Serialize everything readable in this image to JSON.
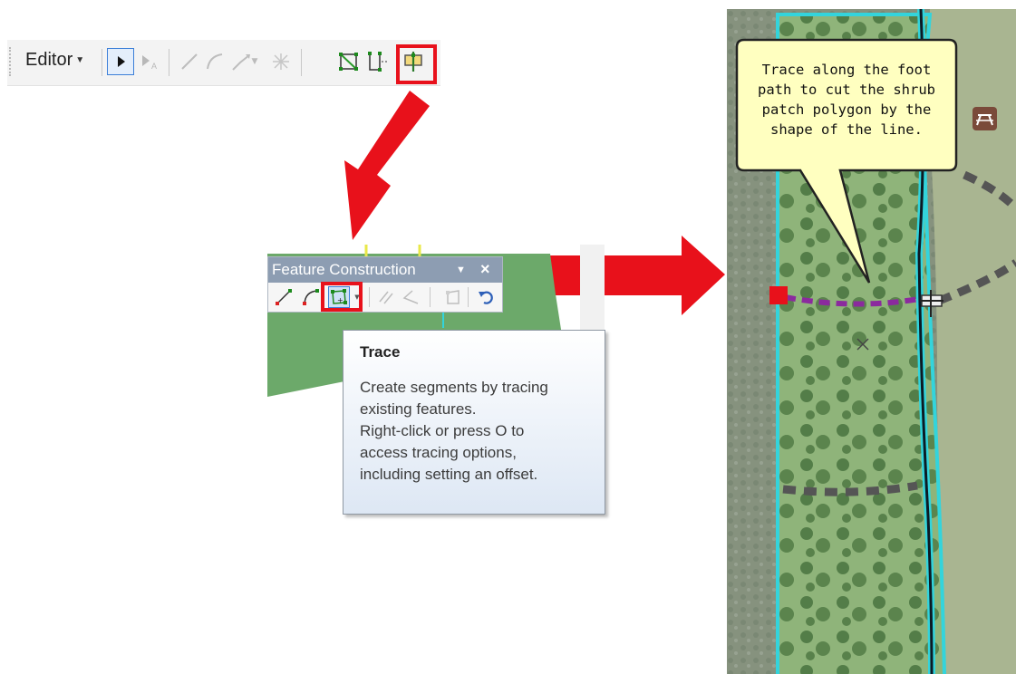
{
  "editor_toolbar": {
    "menu_label": "Editor",
    "tools": [
      "pointer-icon",
      "edit-annotation-icon",
      "straight-segment-icon",
      "end-point-arc-icon",
      "trace-line-icon",
      "midpoint-icon",
      "edit-vertices-icon",
      "reshape-feature-icon",
      "cut-polygons-icon"
    ]
  },
  "feature_construction": {
    "title": "Feature Construction",
    "tools": [
      "straight-segment-icon",
      "arc-segment-icon",
      "trace-icon",
      "parallel-icon",
      "angle-icon",
      "polygon-icon",
      "undo-icon"
    ]
  },
  "tooltip": {
    "title": "Trace",
    "lines": [
      "Create segments by tracing",
      "existing features.",
      "Right-click or press O to",
      "access tracing options,",
      "including setting an offset."
    ]
  },
  "map": {
    "callout_lines": [
      "Trace along the foot",
      "path to cut the shrub",
      "patch polygon by the",
      "shape of the line."
    ]
  },
  "colors": {
    "highlight_red": "#e8111b",
    "feature_green": "#6ca96a",
    "boundary_cyan": "#33d4dc",
    "trace_purple": "#8b2a9e",
    "path_gray": "#555555",
    "tooltip_gradient_end": "#dde7f4"
  }
}
